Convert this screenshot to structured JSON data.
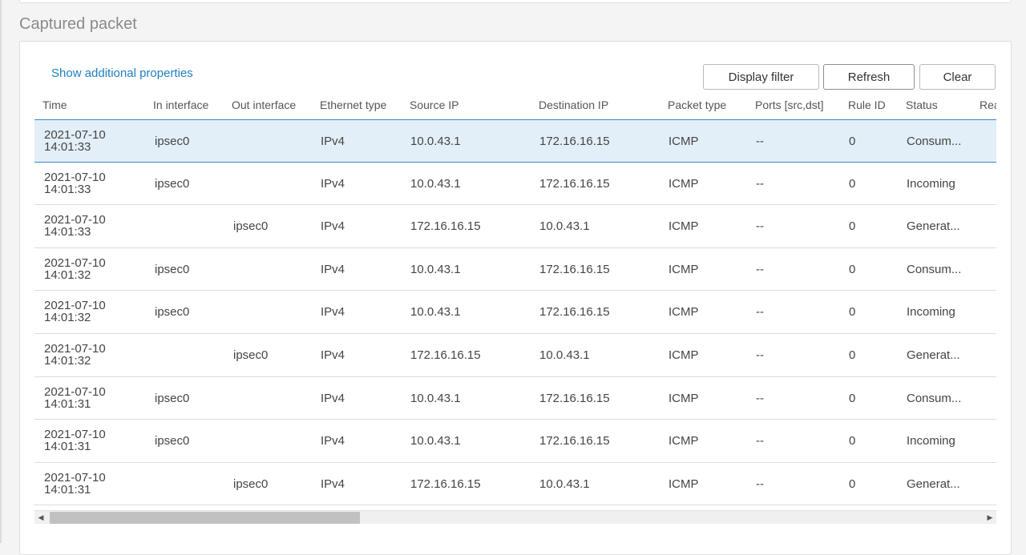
{
  "section_title": "Captured packet",
  "actions": {
    "show_additional_properties": "Show additional properties",
    "display_filter": "Display filter",
    "refresh": "Refresh",
    "clear": "Clear"
  },
  "columns": [
    "Time",
    "In interface",
    "Out interface",
    "Ethernet type",
    "Source IP",
    "Destination IP",
    "Packet type",
    "Ports [src,dst]",
    "Rule ID",
    "Status",
    "Rea"
  ],
  "rows": [
    {
      "date": "2021-07-10",
      "time": "14:01:33",
      "in": "ipsec0",
      "out": "",
      "eth": "IPv4",
      "src": "10.0.43.1",
      "dst": "172.16.16.15",
      "pkt": "ICMP",
      "ports": "--",
      "rule": "0",
      "status": "Consum...",
      "selected": true
    },
    {
      "date": "2021-07-10",
      "time": "14:01:33",
      "in": "ipsec0",
      "out": "",
      "eth": "IPv4",
      "src": "10.0.43.1",
      "dst": "172.16.16.15",
      "pkt": "ICMP",
      "ports": "--",
      "rule": "0",
      "status": "Incoming"
    },
    {
      "date": "2021-07-10",
      "time": "14:01:33",
      "in": "",
      "out": "ipsec0",
      "eth": "IPv4",
      "src": "172.16.16.15",
      "dst": "10.0.43.1",
      "pkt": "ICMP",
      "ports": "--",
      "rule": "0",
      "status": "Generat..."
    },
    {
      "date": "2021-07-10",
      "time": "14:01:32",
      "in": "ipsec0",
      "out": "",
      "eth": "IPv4",
      "src": "10.0.43.1",
      "dst": "172.16.16.15",
      "pkt": "ICMP",
      "ports": "--",
      "rule": "0",
      "status": "Consum..."
    },
    {
      "date": "2021-07-10",
      "time": "14:01:32",
      "in": "ipsec0",
      "out": "",
      "eth": "IPv4",
      "src": "10.0.43.1",
      "dst": "172.16.16.15",
      "pkt": "ICMP",
      "ports": "--",
      "rule": "0",
      "status": "Incoming"
    },
    {
      "date": "2021-07-10",
      "time": "14:01:32",
      "in": "",
      "out": "ipsec0",
      "eth": "IPv4",
      "src": "172.16.16.15",
      "dst": "10.0.43.1",
      "pkt": "ICMP",
      "ports": "--",
      "rule": "0",
      "status": "Generat..."
    },
    {
      "date": "2021-07-10",
      "time": "14:01:31",
      "in": "ipsec0",
      "out": "",
      "eth": "IPv4",
      "src": "10.0.43.1",
      "dst": "172.16.16.15",
      "pkt": "ICMP",
      "ports": "--",
      "rule": "0",
      "status": "Consum..."
    },
    {
      "date": "2021-07-10",
      "time": "14:01:31",
      "in": "ipsec0",
      "out": "",
      "eth": "IPv4",
      "src": "10.0.43.1",
      "dst": "172.16.16.15",
      "pkt": "ICMP",
      "ports": "--",
      "rule": "0",
      "status": "Incoming"
    },
    {
      "date": "2021-07-10",
      "time": "14:01:31",
      "in": "",
      "out": "ipsec0",
      "eth": "IPv4",
      "src": "172.16.16.15",
      "dst": "10.0.43.1",
      "pkt": "ICMP",
      "ports": "--",
      "rule": "0",
      "status": "Generat..."
    }
  ],
  "scrollbar": {
    "left_icon": "scroll-left-icon",
    "right_icon": "scroll-right-icon"
  },
  "colors": {
    "link": "#1f7fc0",
    "selected_row": "#e3eff8",
    "selected_border": "#3f86c6"
  }
}
